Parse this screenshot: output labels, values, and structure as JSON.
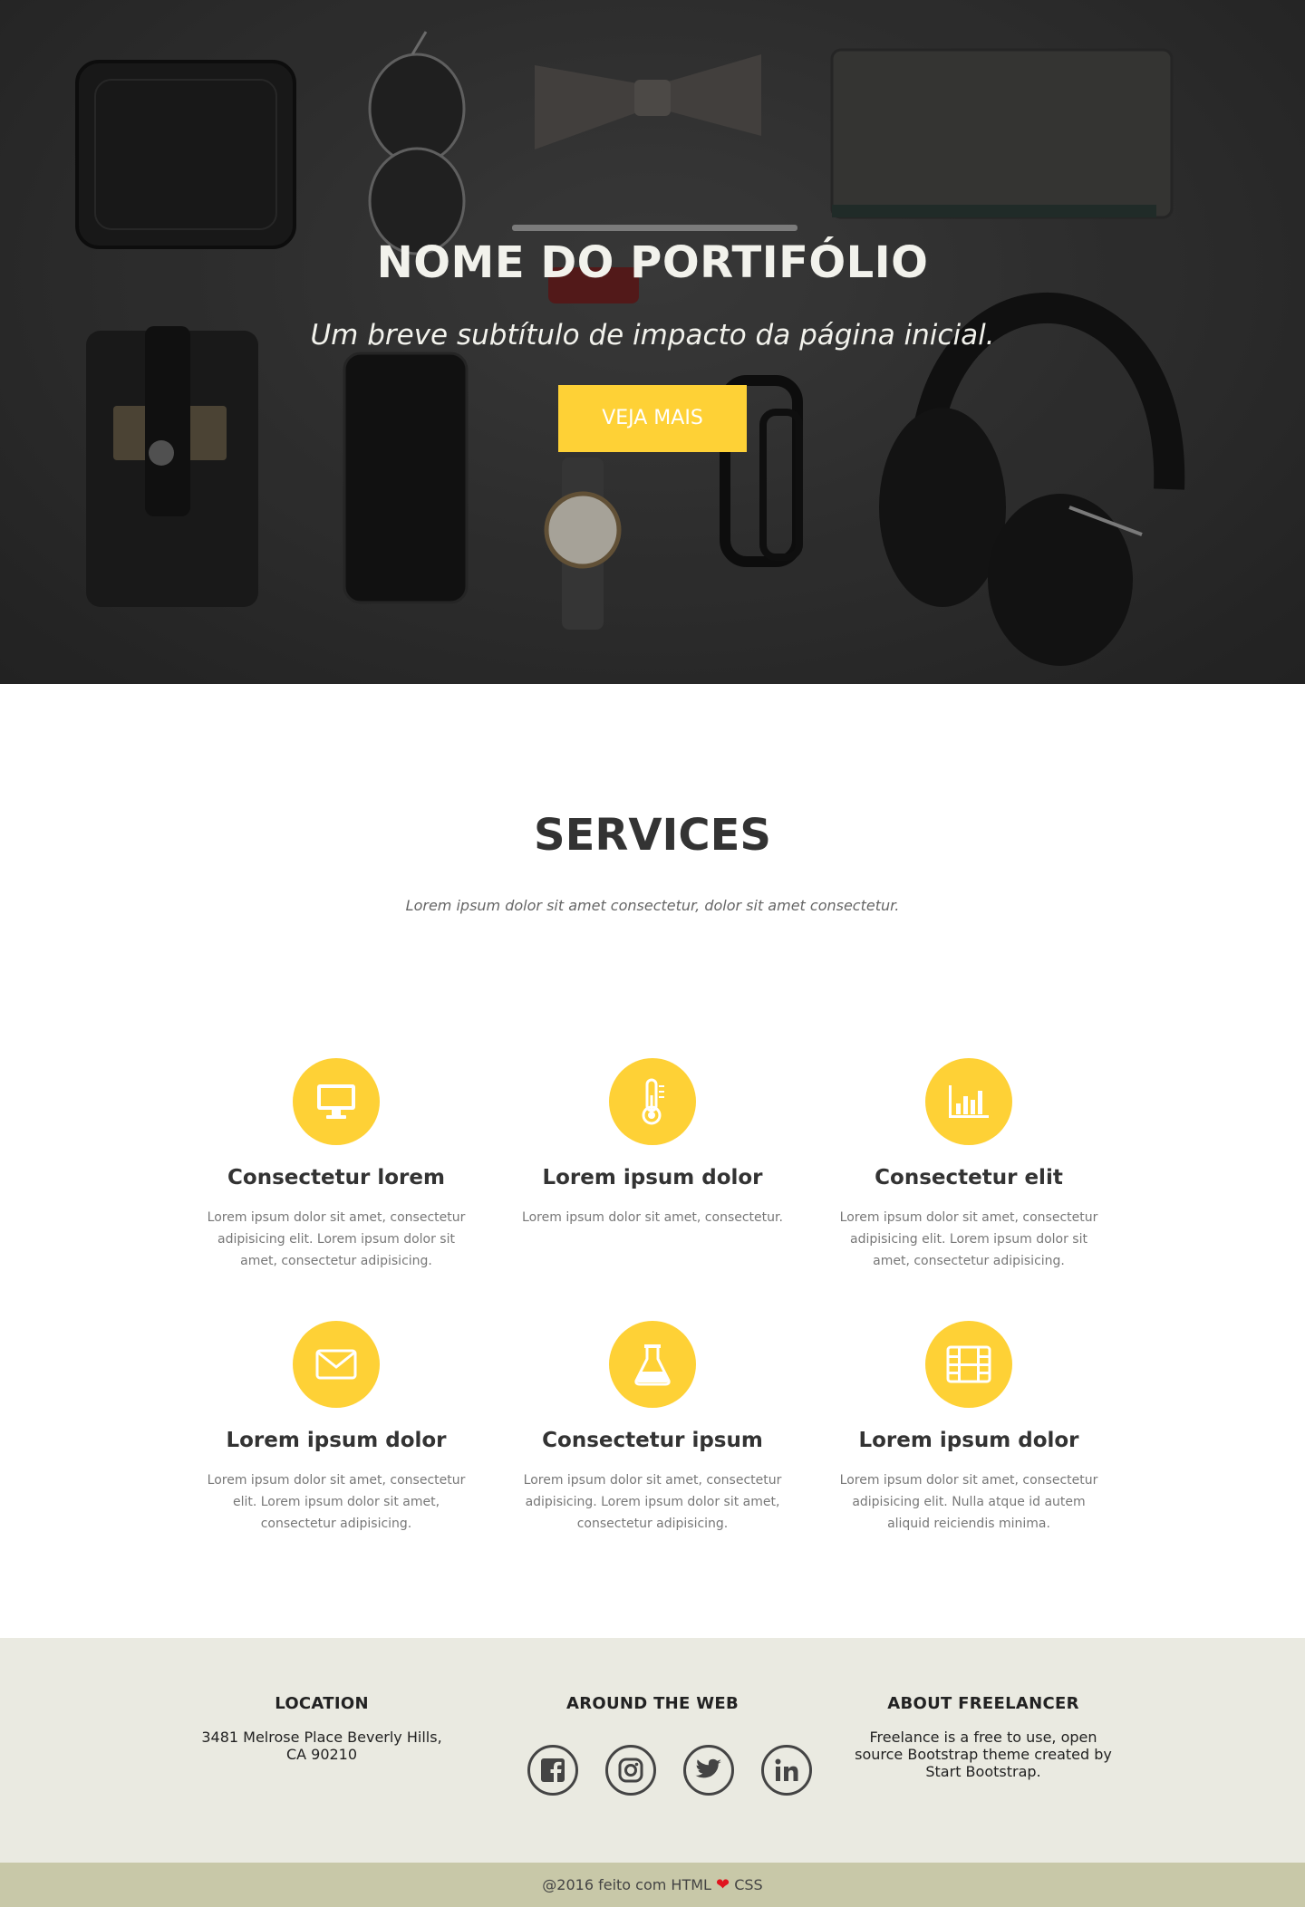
{
  "hero": {
    "title": "NOME DO PORTIFÓLIO",
    "subtitle": "Um breve subtítulo de impacto da página inicial.",
    "button_label": "VEJA MAIS",
    "button_color": "#fed136"
  },
  "services": {
    "title": "SERVICES",
    "subtitle": "Lorem ipsum dolor sit amet consectetur, dolor sit amet consectetur.",
    "items": [
      {
        "icon": "desktop-icon",
        "title": "Consectetur lorem",
        "text": "Lorem ipsum dolor sit amet, consectetur adipisicing elit. Lorem ipsum dolor sit amet, consectetur adipisicing."
      },
      {
        "icon": "thermometer-icon",
        "title": "Lorem ipsum dolor",
        "text": "Lorem ipsum dolor sit amet, consectetur."
      },
      {
        "icon": "bar-chart-icon",
        "title": "Consectetur elit",
        "text": "Lorem ipsum dolor sit amet, consectetur adipisicing elit. Lorem ipsum dolor sit amet, consectetur adipisicing."
      },
      {
        "icon": "envelope-icon",
        "title": "Lorem ipsum dolor",
        "text": "Lorem ipsum dolor sit amet, consectetur elit. Lorem ipsum dolor sit amet, consectetur adipisicing."
      },
      {
        "icon": "flask-icon",
        "title": "Consectetur ipsum",
        "text": "Lorem ipsum dolor sit amet, consectetur adipisicing. Lorem ipsum dolor sit amet, consectetur adipisicing."
      },
      {
        "icon": "film-icon",
        "title": "Lorem ipsum dolor",
        "text": "Lorem ipsum dolor sit amet, consectetur adipisicing elit. Nulla atque id autem aliquid reiciendis minima."
      }
    ]
  },
  "footer": {
    "location_title": "LOCATION",
    "location_text": "3481 Melrose Place Beverly Hills, CA 90210",
    "web_title": "AROUND THE WEB",
    "social_icons": [
      "facebook-icon",
      "instagram-icon",
      "twitter-icon",
      "linkedin-icon"
    ],
    "about_title": "ABOUT FREELANCER",
    "about_text": "Freelance is a free to use, open source Bootstrap theme created by Start Bootstrap."
  },
  "bottom_bar": {
    "prefix": "@2016 feito com HTML",
    "heart": "❤",
    "suffix": "CSS"
  },
  "colors": {
    "accent": "#fed136",
    "footer_bg": "#eaeae1",
    "bottom_bar_bg": "#c8c8a8",
    "heart": "#e0141e"
  }
}
